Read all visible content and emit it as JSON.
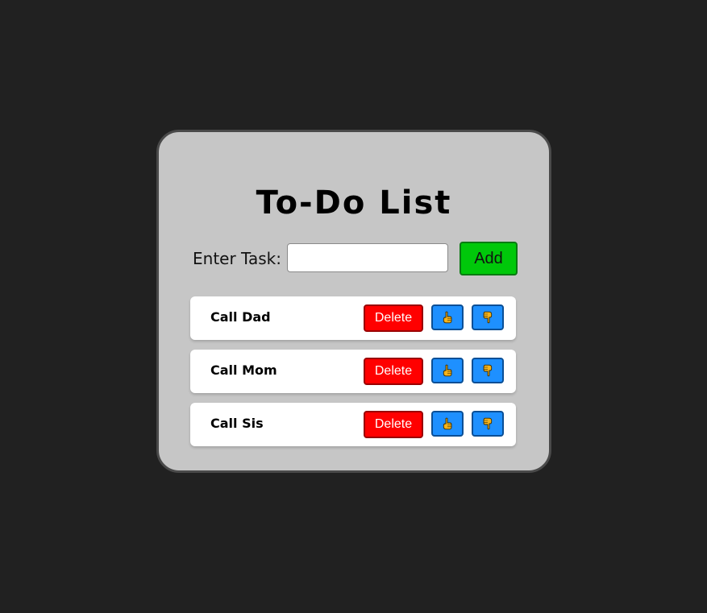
{
  "app": {
    "title": "To-Do List"
  },
  "form": {
    "label": "Enter Task:",
    "input_value": "",
    "add_label": "Add"
  },
  "tasks": [
    {
      "text": "Call Dad",
      "delete_label": "Delete",
      "up_icon": "thumb-up-icon",
      "down_icon": "thumb-down-icon"
    },
    {
      "text": "Call Mom",
      "delete_label": "Delete",
      "up_icon": "thumb-up-icon",
      "down_icon": "thumb-down-icon"
    },
    {
      "text": "Call Sis",
      "delete_label": "Delete",
      "up_icon": "thumb-up-icon",
      "down_icon": "thumb-down-icon"
    }
  ],
  "colors": {
    "background": "#212121",
    "card": "#c6c6c6",
    "add_button": "#00c80a",
    "delete_button": "#ff0000",
    "vote_button": "#1e90ff",
    "hand_icon": "#f5b31a"
  }
}
